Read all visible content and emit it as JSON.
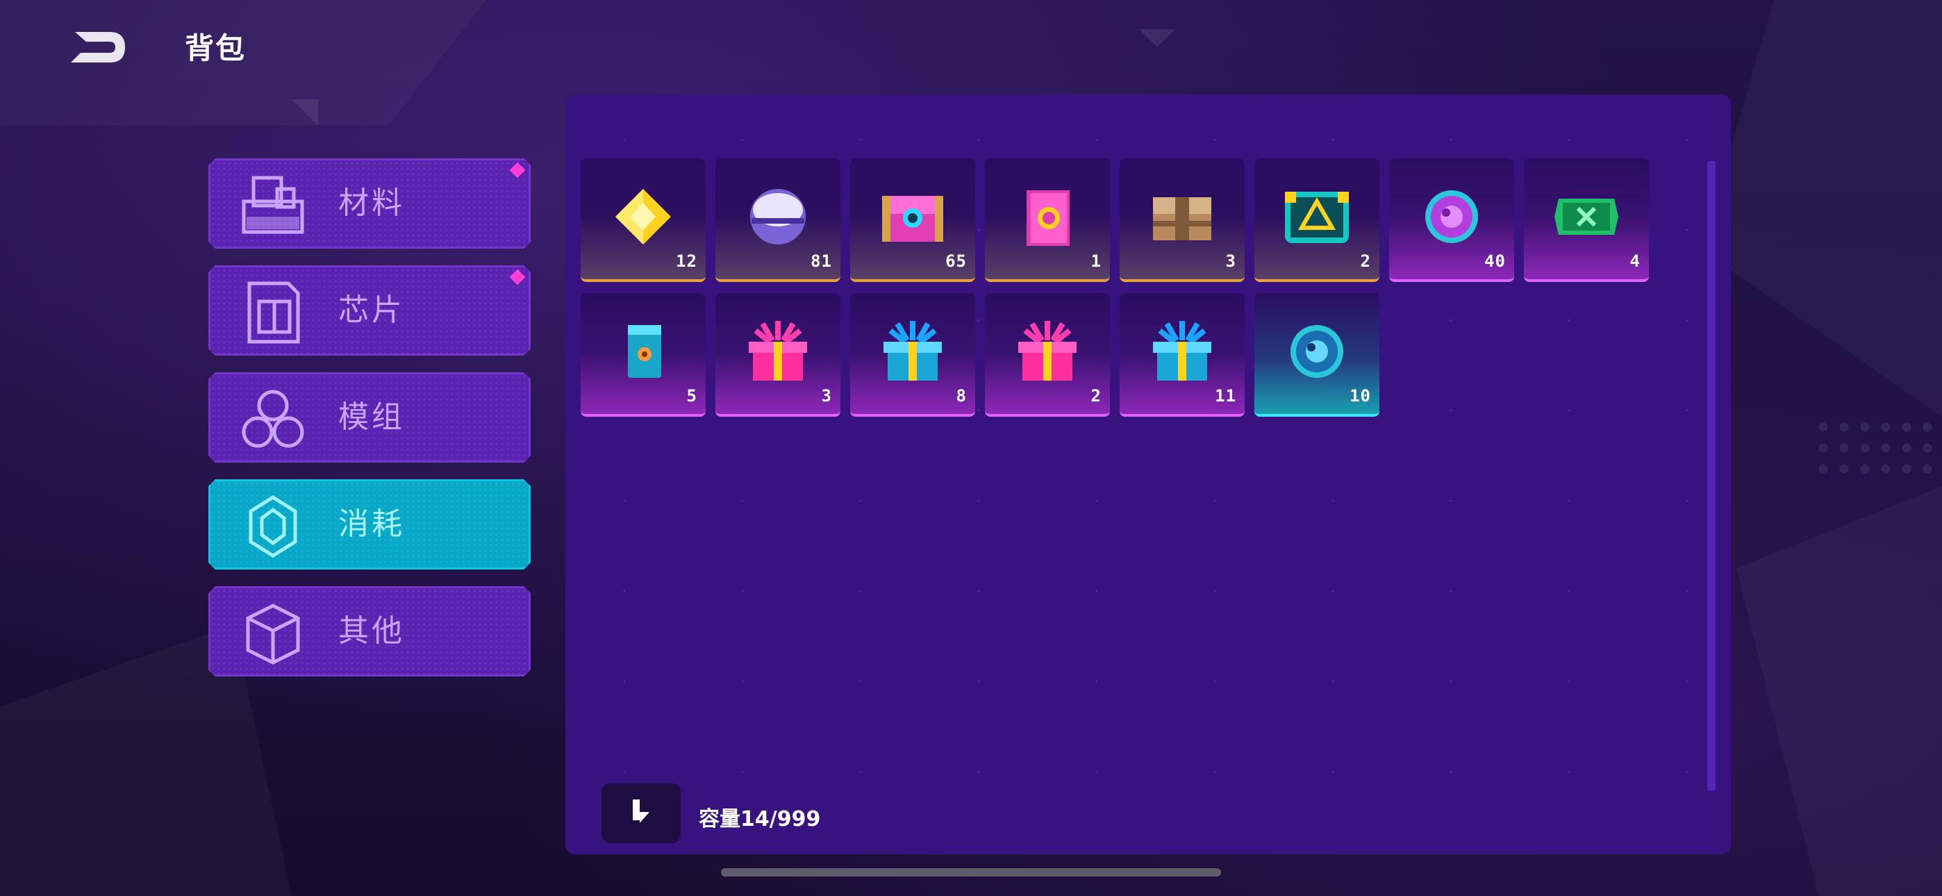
{
  "header": {
    "title": "背包"
  },
  "sidebar": {
    "tabs": [
      {
        "label": "材料",
        "icon": "material-icon",
        "active": false,
        "badge": true
      },
      {
        "label": "芯片",
        "icon": "chip-icon",
        "active": false,
        "badge": true
      },
      {
        "label": "模组",
        "icon": "module-icon",
        "active": false,
        "badge": false
      },
      {
        "label": "消耗",
        "icon": "consumable-icon",
        "active": true,
        "badge": false
      },
      {
        "label": "其他",
        "icon": "other-icon",
        "active": false,
        "badge": false
      }
    ]
  },
  "inventory": {
    "items": [
      {
        "icon": "yellow-crystal-icon",
        "qty": "12",
        "rarity": "gold"
      },
      {
        "icon": "purple-orb-icon",
        "qty": "81",
        "rarity": "gold"
      },
      {
        "icon": "treasure-chest-icon",
        "qty": "65",
        "rarity": "gold"
      },
      {
        "icon": "spell-book-icon",
        "qty": "1",
        "rarity": "gold"
      },
      {
        "icon": "wooden-chest-icon",
        "qty": "3",
        "rarity": "gold"
      },
      {
        "icon": "ornate-chest-icon",
        "qty": "2",
        "rarity": "gold"
      },
      {
        "icon": "purple-token-icon",
        "qty": "40",
        "rarity": "purple"
      },
      {
        "icon": "green-ticket-icon",
        "qty": "4",
        "rarity": "purple"
      },
      {
        "icon": "blue-card-icon",
        "qty": "5",
        "rarity": "purple"
      },
      {
        "icon": "pink-gift-icon",
        "qty": "3",
        "rarity": "purple"
      },
      {
        "icon": "blue-gift-icon",
        "qty": "8",
        "rarity": "purple"
      },
      {
        "icon": "pink-gift-icon",
        "qty": "2",
        "rarity": "purple"
      },
      {
        "icon": "blue-gift-icon",
        "qty": "11",
        "rarity": "purple"
      },
      {
        "icon": "blue-token-icon",
        "qty": "10",
        "rarity": "cyan"
      }
    ],
    "capacity_label": "容量14/999"
  },
  "colors": {
    "panel": "#381380",
    "tab": "#5b23b1",
    "tab_active": "#08a8c9",
    "badge": "#ff3fd7"
  }
}
